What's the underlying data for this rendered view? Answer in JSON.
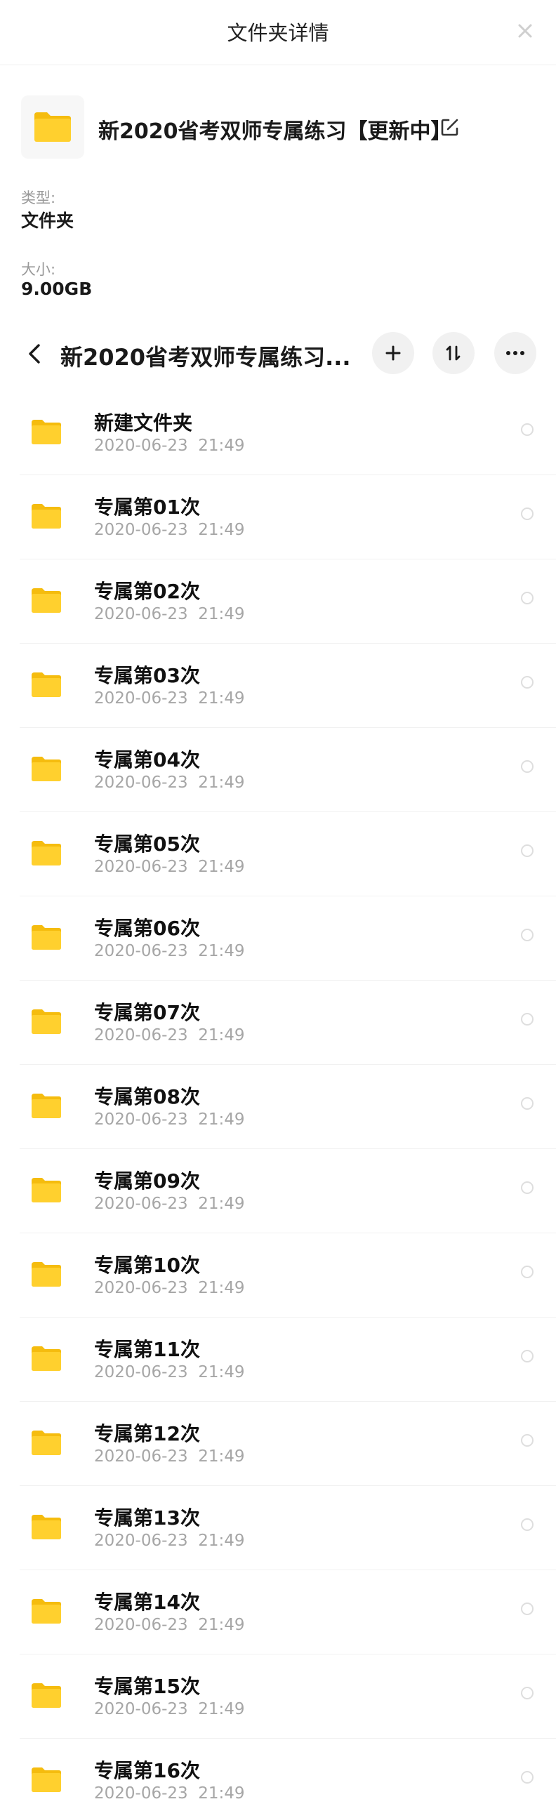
{
  "header": {
    "title": "文件夹详情",
    "close_icon": "close-icon"
  },
  "folder_info": {
    "icon": "folder-icon",
    "name": "新2020省考双师专属练习【更新中】",
    "edit_icon": "edit-icon",
    "type_label": "类型:",
    "type_value": "文件夹",
    "size_label": "大小:",
    "size_value": "9.00GB"
  },
  "nav": {
    "back_icon": "chevron-left-icon",
    "title": "新2020省考双师专属练习...",
    "add_icon": "plus-icon",
    "sort_icon": "sort-icon",
    "more_icon": "more-horizontal-icon"
  },
  "colors": {
    "folder": "#FFD02E",
    "folder_back": "#F5BC0E",
    "text_primary": "#1a1a1a",
    "text_secondary": "#a6a6a6"
  },
  "list": {
    "items": [
      {
        "name": "新建文件夹",
        "date": "2020-06-23  21:49"
      },
      {
        "name": "专属第01次",
        "date": "2020-06-23  21:49"
      },
      {
        "name": "专属第02次",
        "date": "2020-06-23  21:49"
      },
      {
        "name": "专属第03次",
        "date": "2020-06-23  21:49"
      },
      {
        "name": "专属第04次",
        "date": "2020-06-23  21:49"
      },
      {
        "name": "专属第05次",
        "date": "2020-06-23  21:49"
      },
      {
        "name": "专属第06次",
        "date": "2020-06-23  21:49"
      },
      {
        "name": "专属第07次",
        "date": "2020-06-23  21:49"
      },
      {
        "name": "专属第08次",
        "date": "2020-06-23  21:49"
      },
      {
        "name": "专属第09次",
        "date": "2020-06-23  21:49"
      },
      {
        "name": "专属第10次",
        "date": "2020-06-23  21:49"
      },
      {
        "name": "专属第11次",
        "date": "2020-06-23  21:49"
      },
      {
        "name": "专属第12次",
        "date": "2020-06-23  21:49"
      },
      {
        "name": "专属第13次",
        "date": "2020-06-23  21:49"
      },
      {
        "name": "专属第14次",
        "date": "2020-06-23  21:49"
      },
      {
        "name": "专属第15次",
        "date": "2020-06-23  21:49"
      },
      {
        "name": "专属第16次",
        "date": "2020-06-23  21:49"
      }
    ]
  }
}
